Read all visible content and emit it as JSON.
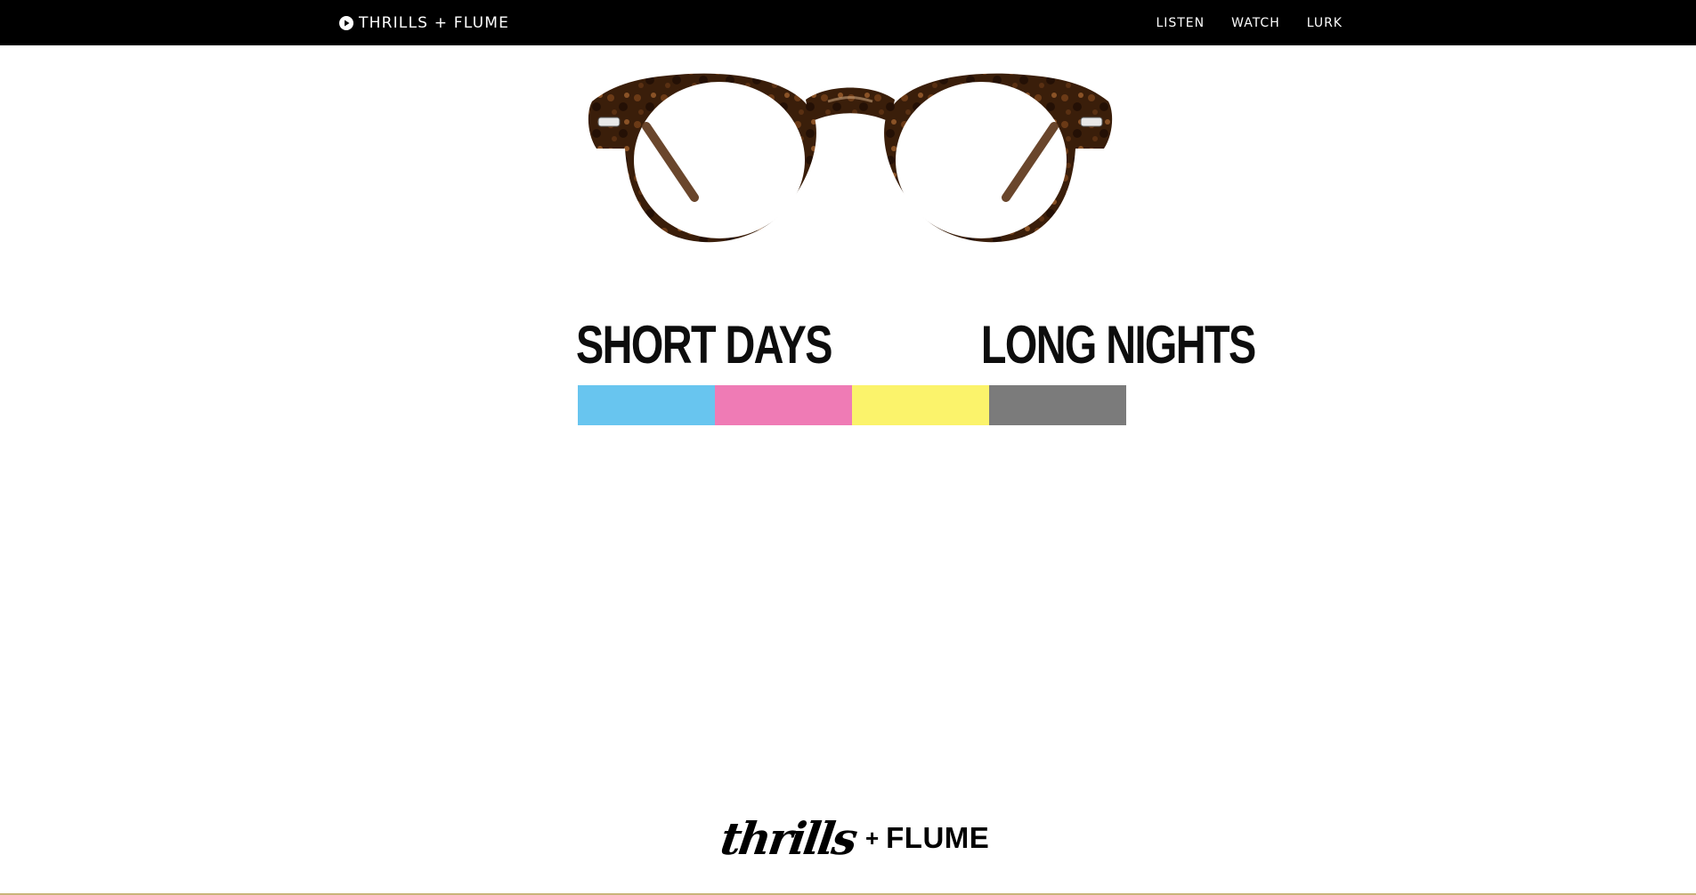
{
  "header": {
    "brand": "THRILLS + FLUME",
    "brand_icon": "play-circle-icon",
    "nav": [
      {
        "label": "LISTEN"
      },
      {
        "label": "WATCH"
      },
      {
        "label": "LURK"
      }
    ]
  },
  "hero": {
    "image": "tortoiseshell-eyeglasses",
    "headline_left": "SHORT DAYS",
    "headline_right": "LONG NIGHTS",
    "color_swatches": [
      "#68c5ef",
      "#ef7bb5",
      "#fbf36b",
      "#7b7b7b"
    ]
  },
  "footer": {
    "logo_script": "thrills",
    "logo_plus": "+",
    "logo_word": "FLUME"
  },
  "colors": {
    "navbar_bg": "#000000",
    "navbar_text": "#ffffff",
    "background": "#ffffff",
    "frame_dark": "#2a1608",
    "frame_mid": "#5a3216",
    "bottom_rule": "#c8b47a"
  }
}
